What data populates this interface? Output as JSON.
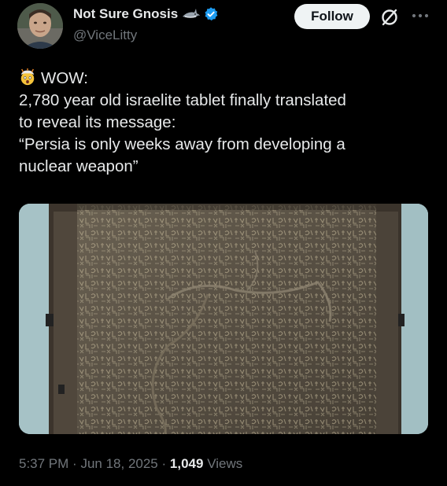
{
  "author": {
    "display_name": "Not Sure Gnosis",
    "handle": "@ViceLitty",
    "badge_icons": [
      "shark-emoji-icon",
      "verified-badge-icon"
    ]
  },
  "actions": {
    "follow_label": "Follow",
    "grok_icon": "grok-icon",
    "more_icon": "more-options-icon"
  },
  "tweet": {
    "emoji": "exploding-head-emoji",
    "lines": [
      "WOW:",
      "2,780 year old israelite tablet finally translated",
      "to reveal its message:",
      "“Persia is only weeks away from developing a",
      "nuclear weapon”"
    ]
  },
  "media": {
    "kind": "photo",
    "subject": "ancient inscribed stone tablet"
  },
  "meta": {
    "time": "5:37 PM",
    "separator": "·",
    "date": "Jun 18, 2025",
    "views_count": "1,049",
    "views_label": "Views"
  },
  "colors": {
    "background": "#000000",
    "primary_text": "#e7e9ea",
    "secondary_text": "#71767b",
    "verified_blue": "#1d9bf0",
    "follow_button_bg": "#eff3f4"
  }
}
